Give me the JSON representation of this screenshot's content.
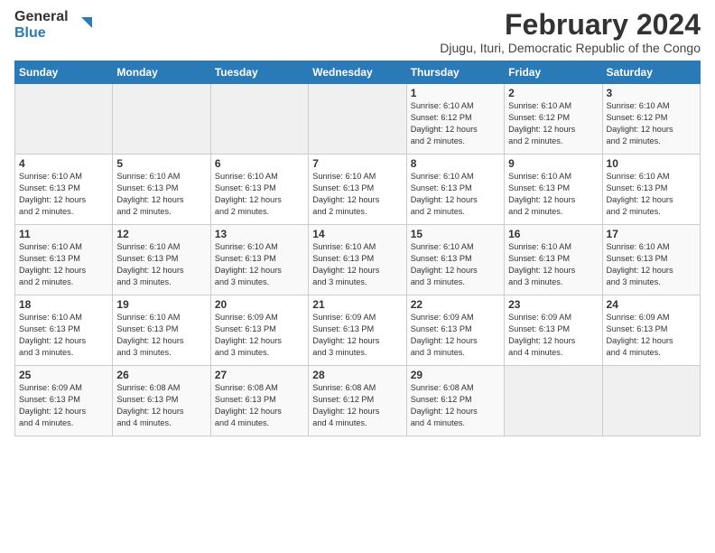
{
  "logo": {
    "text_general": "General",
    "text_blue": "Blue"
  },
  "header": {
    "title": "February 2024",
    "subtitle": "Djugu, Ituri, Democratic Republic of the Congo"
  },
  "columns": [
    "Sunday",
    "Monday",
    "Tuesday",
    "Wednesday",
    "Thursday",
    "Friday",
    "Saturday"
  ],
  "weeks": [
    [
      {
        "day": "",
        "detail": ""
      },
      {
        "day": "",
        "detail": ""
      },
      {
        "day": "",
        "detail": ""
      },
      {
        "day": "",
        "detail": ""
      },
      {
        "day": "1",
        "detail": "Sunrise: 6:10 AM\nSunset: 6:12 PM\nDaylight: 12 hours\nand 2 minutes."
      },
      {
        "day": "2",
        "detail": "Sunrise: 6:10 AM\nSunset: 6:12 PM\nDaylight: 12 hours\nand 2 minutes."
      },
      {
        "day": "3",
        "detail": "Sunrise: 6:10 AM\nSunset: 6:12 PM\nDaylight: 12 hours\nand 2 minutes."
      }
    ],
    [
      {
        "day": "4",
        "detail": "Sunrise: 6:10 AM\nSunset: 6:13 PM\nDaylight: 12 hours\nand 2 minutes."
      },
      {
        "day": "5",
        "detail": "Sunrise: 6:10 AM\nSunset: 6:13 PM\nDaylight: 12 hours\nand 2 minutes."
      },
      {
        "day": "6",
        "detail": "Sunrise: 6:10 AM\nSunset: 6:13 PM\nDaylight: 12 hours\nand 2 minutes."
      },
      {
        "day": "7",
        "detail": "Sunrise: 6:10 AM\nSunset: 6:13 PM\nDaylight: 12 hours\nand 2 minutes."
      },
      {
        "day": "8",
        "detail": "Sunrise: 6:10 AM\nSunset: 6:13 PM\nDaylight: 12 hours\nand 2 minutes."
      },
      {
        "day": "9",
        "detail": "Sunrise: 6:10 AM\nSunset: 6:13 PM\nDaylight: 12 hours\nand 2 minutes."
      },
      {
        "day": "10",
        "detail": "Sunrise: 6:10 AM\nSunset: 6:13 PM\nDaylight: 12 hours\nand 2 minutes."
      }
    ],
    [
      {
        "day": "11",
        "detail": "Sunrise: 6:10 AM\nSunset: 6:13 PM\nDaylight: 12 hours\nand 2 minutes."
      },
      {
        "day": "12",
        "detail": "Sunrise: 6:10 AM\nSunset: 6:13 PM\nDaylight: 12 hours\nand 3 minutes."
      },
      {
        "day": "13",
        "detail": "Sunrise: 6:10 AM\nSunset: 6:13 PM\nDaylight: 12 hours\nand 3 minutes."
      },
      {
        "day": "14",
        "detail": "Sunrise: 6:10 AM\nSunset: 6:13 PM\nDaylight: 12 hours\nand 3 minutes."
      },
      {
        "day": "15",
        "detail": "Sunrise: 6:10 AM\nSunset: 6:13 PM\nDaylight: 12 hours\nand 3 minutes."
      },
      {
        "day": "16",
        "detail": "Sunrise: 6:10 AM\nSunset: 6:13 PM\nDaylight: 12 hours\nand 3 minutes."
      },
      {
        "day": "17",
        "detail": "Sunrise: 6:10 AM\nSunset: 6:13 PM\nDaylight: 12 hours\nand 3 minutes."
      }
    ],
    [
      {
        "day": "18",
        "detail": "Sunrise: 6:10 AM\nSunset: 6:13 PM\nDaylight: 12 hours\nand 3 minutes."
      },
      {
        "day": "19",
        "detail": "Sunrise: 6:10 AM\nSunset: 6:13 PM\nDaylight: 12 hours\nand 3 minutes."
      },
      {
        "day": "20",
        "detail": "Sunrise: 6:09 AM\nSunset: 6:13 PM\nDaylight: 12 hours\nand 3 minutes."
      },
      {
        "day": "21",
        "detail": "Sunrise: 6:09 AM\nSunset: 6:13 PM\nDaylight: 12 hours\nand 3 minutes."
      },
      {
        "day": "22",
        "detail": "Sunrise: 6:09 AM\nSunset: 6:13 PM\nDaylight: 12 hours\nand 3 minutes."
      },
      {
        "day": "23",
        "detail": "Sunrise: 6:09 AM\nSunset: 6:13 PM\nDaylight: 12 hours\nand 4 minutes."
      },
      {
        "day": "24",
        "detail": "Sunrise: 6:09 AM\nSunset: 6:13 PM\nDaylight: 12 hours\nand 4 minutes."
      }
    ],
    [
      {
        "day": "25",
        "detail": "Sunrise: 6:09 AM\nSunset: 6:13 PM\nDaylight: 12 hours\nand 4 minutes."
      },
      {
        "day": "26",
        "detail": "Sunrise: 6:08 AM\nSunset: 6:13 PM\nDaylight: 12 hours\nand 4 minutes."
      },
      {
        "day": "27",
        "detail": "Sunrise: 6:08 AM\nSunset: 6:13 PM\nDaylight: 12 hours\nand 4 minutes."
      },
      {
        "day": "28",
        "detail": "Sunrise: 6:08 AM\nSunset: 6:12 PM\nDaylight: 12 hours\nand 4 minutes."
      },
      {
        "day": "29",
        "detail": "Sunrise: 6:08 AM\nSunset: 6:12 PM\nDaylight: 12 hours\nand 4 minutes."
      },
      {
        "day": "",
        "detail": ""
      },
      {
        "day": "",
        "detail": ""
      }
    ]
  ]
}
